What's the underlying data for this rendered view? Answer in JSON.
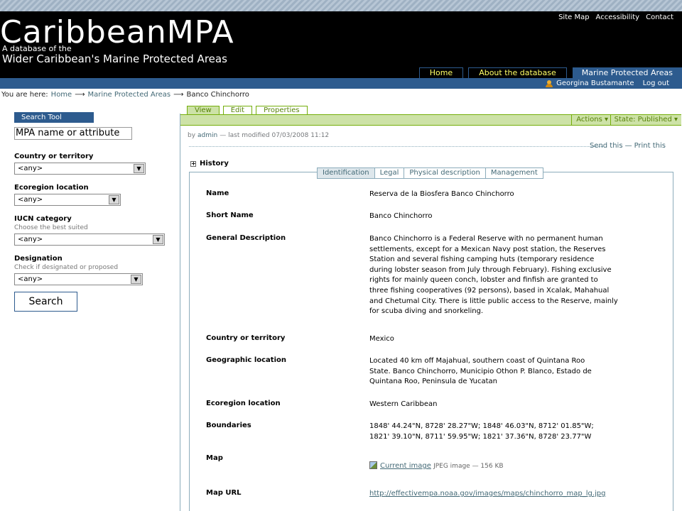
{
  "header": {
    "logo": "CaribbeanMPA",
    "tagline1": "A database of the",
    "tagline2": "Wider Caribbean's Marine Protected Areas",
    "site_actions": [
      "Site Map",
      "Accessibility",
      "Contact"
    ]
  },
  "global_nav": [
    {
      "label": "Home",
      "selected": false
    },
    {
      "label": "About the database",
      "selected": false
    },
    {
      "label": "Marine Protected Areas",
      "selected": true
    }
  ],
  "personal_bar": {
    "user": "Georgina Bustamante",
    "logout": "Log out"
  },
  "breadcrumbs": {
    "prefix": "You are here:",
    "items": [
      "Home",
      "Marine Protected Areas",
      "Banco Chinchorro"
    ],
    "separator": "⟶"
  },
  "search_portlet": {
    "title": "Search Tool",
    "searchable_value": "MPA name or attribute",
    "country_label": "Country or territory",
    "country_value": "<any>",
    "ecoregion_label": "Ecoregion location",
    "ecoregion_value": "<any>",
    "iucn_label": "IUCN category",
    "iucn_help": "Choose the best suited",
    "iucn_value": "<any>",
    "designation_label": "Designation",
    "designation_help": "Check if designated or proposed",
    "designation_value": "<any>",
    "search_button": "Search"
  },
  "content_tabs": [
    {
      "label": "View",
      "selected": true
    },
    {
      "label": "Edit",
      "selected": false
    },
    {
      "label": "Properties",
      "selected": false
    }
  ],
  "content_bar": {
    "actions": "Actions ▾",
    "state": "State: Published ▾"
  },
  "byline": {
    "by": "by",
    "author": "admin",
    "modified": "— last modified 07/03/2008 11:12"
  },
  "document_actions": {
    "send": "Send this",
    "sep": "—",
    "print": "Print this"
  },
  "history": {
    "label": "History"
  },
  "field_tabs": [
    {
      "label": "Identification",
      "selected": true
    },
    {
      "label": "Legal",
      "selected": false
    },
    {
      "label": "Physical description",
      "selected": false
    },
    {
      "label": "Management",
      "selected": false
    }
  ],
  "fields": {
    "name": {
      "label": "Name",
      "value": "Reserva de la Biosfera Banco Chinchorro"
    },
    "short_name": {
      "label": "Short Name",
      "value": "Banco Chinchorro"
    },
    "description": {
      "label": "General Description",
      "value": "Banco Chinchorro is a Federal Reserve with no permanent human settlements, except for a Mexican Navy post station, the Reserves Station  and several fishing camping huts (temporary residence during lobster season from July through February). Fishing exclusive rights for mainly queen conch, lobster and finfish are granted to three fishing cooperatives (92 persons), based in Xcalak, Mahahual and Chetumal City. There is little public access to the Reserve, mainly for scuba diving and snorkeling."
    },
    "country": {
      "label": "Country or territory",
      "value": "Mexico"
    },
    "geographic": {
      "label": "Geographic location",
      "value": "Located 40 km off Majahual, southern coast of Quintana Roo State. Banco Chinchorro, Municipio Othon P. Blanco, Estado de Quintana Roo, Peninsula de Yucatan"
    },
    "ecoregion": {
      "label": "Ecoregion location",
      "value": "Western Caribbean"
    },
    "boundaries": {
      "label": "Boundaries",
      "value": "1848' 44.24\"N, 8728' 28.27\"W; 1848' 46.03\"N, 8712' 01.85\"W; 1821' 39.10\"N, 8711' 59.95\"W; 1821' 37.36\"N, 8728' 23.77\"W"
    },
    "map": {
      "label": "Map",
      "link": "Current image",
      "mime": "JPEG image — 156 KB"
    },
    "map_url": {
      "label": "Map URL",
      "value": "http://effectivempa.noaa.gov/images/maps/chinchorro_map_lg.jpg"
    }
  }
}
